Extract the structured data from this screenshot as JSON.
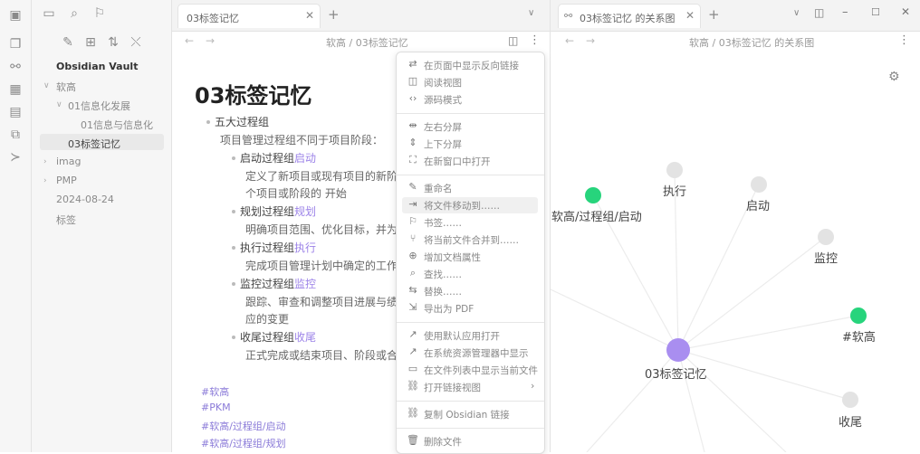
{
  "sidebar": {
    "vault_name": "Obsidian Vault",
    "tree": [
      "软高",
      "01信息化发展",
      "01信息与信息化",
      "03标签记忆",
      "imag",
      "PMP",
      "2024-08-24",
      "标签"
    ]
  },
  "editor": {
    "tab_title": "03标签记忆",
    "breadcrumb": "软高 / 03标签记忆",
    "doc_title": "03标签记忆",
    "lines": {
      "l1": "五大过程组",
      "l2": "项目管理过程组不同于项目阶段：",
      "l3a": "启动过程组",
      "l3b": "启动",
      "l4": "定义了新项目或现有项目的新阶",
      "l5": "个项目或阶段的 开始",
      "l6a": "规划过程组",
      "l6b": "规划",
      "l7": "明确项目范围、优化目标，并为",
      "l8a": "执行过程组",
      "l8b": "执行",
      "l9": "完成项目管理计划中确定的工作",
      "l10a": "监控过程组",
      "l10b": "监控",
      "l11": "跟踪、审查和调整项目进展与绩",
      "l12": "应的变更",
      "l13a": "收尾过程组",
      "l13b": "收尾",
      "l14": "正式完成或结束项目、阶段或合"
    },
    "tags": [
      "#软高",
      "#PKM",
      "#软高/过程组/启动",
      "#软高/过程组/规划"
    ]
  },
  "menu": {
    "items": [
      "在页面中显示反向链接",
      "阅读视图",
      "源码模式",
      "左右分屏",
      "上下分屏",
      "在新窗口中打开",
      "重命名",
      "将文件移动到……",
      "书签……",
      "将当前文件合并到……",
      "增加文档属性",
      "查找……",
      "替换……",
      "导出为 PDF",
      "使用默认应用打开",
      "在系统资源管理器中显示",
      "在文件列表中显示当前文件",
      "打开链接视图",
      "复制 Obsidian 链接",
      "删除文件"
    ]
  },
  "graph": {
    "tab_title": "03标签记忆 的关系图",
    "breadcrumb": "软高 / 03标签记忆 的关系图",
    "nodes": {
      "center": "03标签记忆",
      "zhixing": "执行",
      "qidong": "启动",
      "tag_qidong": "软高/过程组/启动",
      "jiankong": "监控",
      "tag_ruangao": "#软高",
      "shouwei": "收尾"
    }
  },
  "colors": {
    "accent": "#9c83e8",
    "tag_node": "#27d47c",
    "center_node": "#a98ef0",
    "plain_node": "#e0e0e0"
  }
}
